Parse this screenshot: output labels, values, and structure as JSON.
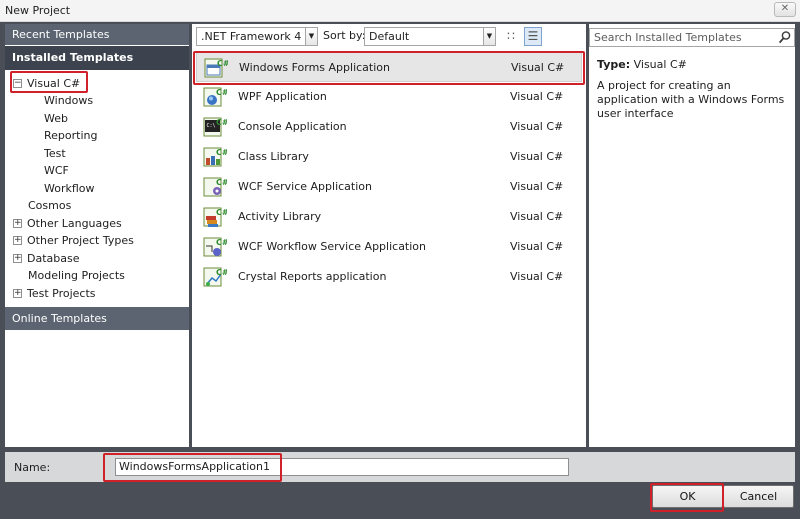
{
  "window": {
    "title": "New Project",
    "close_glyph": "✕"
  },
  "nav": {
    "recent": "Recent Templates",
    "installed": "Installed Templates",
    "online": "Online Templates",
    "tree": [
      {
        "label": "Visual C#",
        "expander": "−",
        "level": 0
      },
      {
        "label": "Windows",
        "level": 1
      },
      {
        "label": "Web",
        "level": 1
      },
      {
        "label": "Reporting",
        "level": 1
      },
      {
        "label": "Test",
        "level": 1
      },
      {
        "label": "WCF",
        "level": 1
      },
      {
        "label": "Workflow",
        "level": 1
      },
      {
        "label": "Cosmos",
        "level": 0
      },
      {
        "label": "Other Languages",
        "expander": "+",
        "level": 0
      },
      {
        "label": "Other Project Types",
        "expander": "+",
        "level": 0
      },
      {
        "label": "Database",
        "expander": "+",
        "level": 0
      },
      {
        "label": "Modeling Projects",
        "level": 0
      },
      {
        "label": "Test Projects",
        "expander": "+",
        "level": 0
      }
    ]
  },
  "toolbar": {
    "framework": ".NET Framework 4",
    "sort_label": "Sort by:",
    "sort_value": "Default",
    "dropdown_glyph": "▼",
    "small_icons_glyph": "∷",
    "list_view_glyph": "☰"
  },
  "templates": [
    {
      "name": "Windows Forms Application",
      "language": "Visual C#",
      "icon": "winforms-icon"
    },
    {
      "name": "WPF Application",
      "language": "Visual C#",
      "icon": "wpf-icon"
    },
    {
      "name": "Console Application",
      "language": "Visual C#",
      "icon": "console-icon"
    },
    {
      "name": "Class Library",
      "language": "Visual C#",
      "icon": "class-library-icon"
    },
    {
      "name": "WCF Service Application",
      "language": "Visual C#",
      "icon": "wcf-service-icon"
    },
    {
      "name": "Activity Library",
      "language": "Visual C#",
      "icon": "activity-library-icon"
    },
    {
      "name": "WCF Workflow Service Application",
      "language": "Visual C#",
      "icon": "wcf-workflow-icon"
    },
    {
      "name": "Crystal Reports application",
      "language": "Visual C#",
      "icon": "crystal-reports-icon"
    }
  ],
  "info": {
    "search_placeholder": "Search Installed Templates",
    "type_label": "Type:",
    "type_value": "Visual C#",
    "description": "A project for creating an application with a Windows Forms user interface"
  },
  "bottom": {
    "name_label": "Name:",
    "name_value": "WindowsFormsApplication1",
    "ok": "OK",
    "cancel": "Cancel"
  },
  "colors": {
    "frame": "#4a4f57",
    "active_header": "#3c434e",
    "annotation": "#d0202a",
    "csharp_green": "#2e8b2e"
  }
}
